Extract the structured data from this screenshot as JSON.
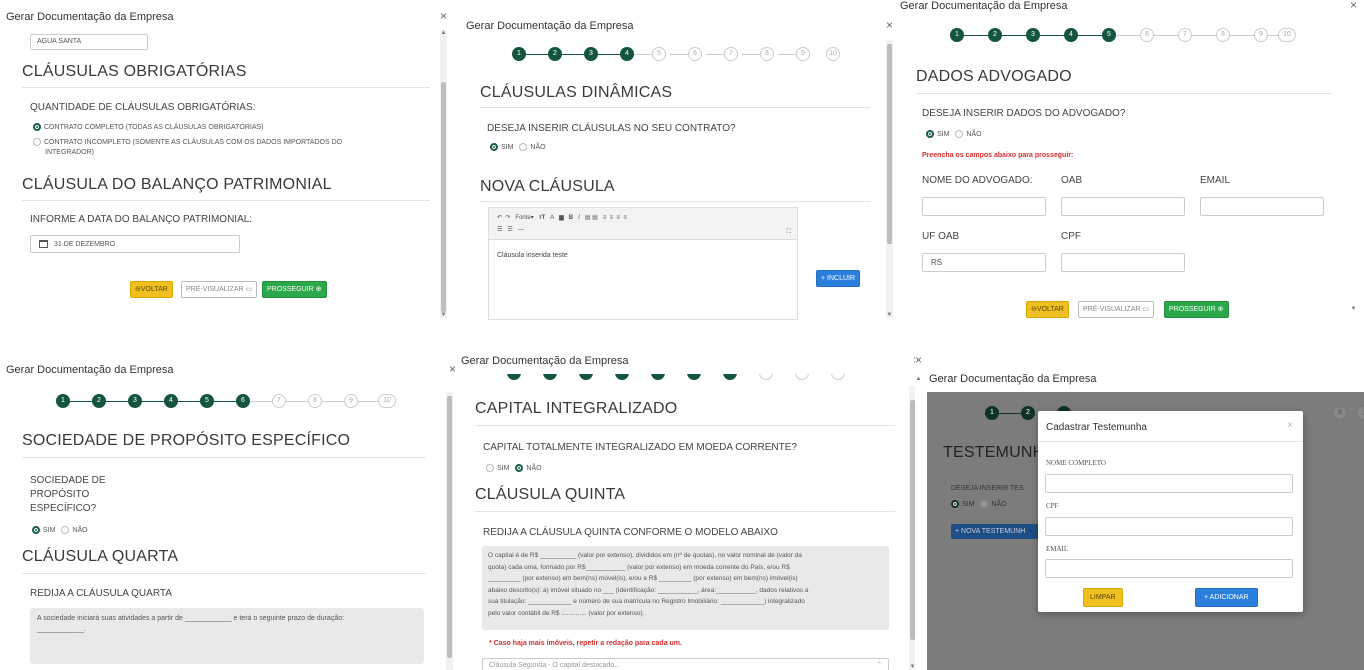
{
  "window_title": "Gerar Documentação da Empresa",
  "close_glyph": "×",
  "steps": [
    "1",
    "2",
    "3",
    "4",
    "5",
    "6",
    "7",
    "8",
    "9",
    "10"
  ],
  "btn": {
    "voltar": "VOLTAR",
    "previsualizar": "PRÉ-VISUALIZAR",
    "prosseguir": "PROSSEGUIR"
  },
  "radio": {
    "sim": "SIM",
    "nao": "NÃO"
  },
  "p1": {
    "city": "AGUA SANTA",
    "h1": "CLÁUSULAS OBRIGATÓRIAS",
    "q": "QUANTIDADE DE CLÁUSULAS OBRIGATÓRIAS:",
    "opt1": "CONTRATO COMPLETO (TODAS AS CLÁUSULAS OBRIGATÓRIAS)",
    "opt2a": "CONTRATO INCOMPLETO (SOMENTE AS CLÁUSULAS COM OS DADOS IMPORTADOS DO",
    "opt2b": "INTEGRADOR)",
    "h2": "CLÁUSULA DO BALANÇO PATRIMONIAL",
    "q2": "INFORME A DATA DO BALANÇO PATRIMONIAL:",
    "date": "31 DE DEZEMBRO"
  },
  "p2": {
    "h1": "CLÁUSULAS DINÂMICAS",
    "q": "DESEJA INSERIR CLÁUSULAS NO SEU CONTRATO?",
    "h2": "NOVA CLÁUSULA",
    "fonte": "Fonte",
    "editor_text": "Cláusula inserida teste",
    "incluir": "+ INCLUIR"
  },
  "p3": {
    "h1": "DADOS ADVOGADO",
    "q": "DESEJA INSERIR DADOS DO ADVOGADO?",
    "warn": "Preencha os campos abaixo para prosseguir:",
    "f_nome": "NOME DO ADVOGADO:",
    "f_oab": "OAB",
    "f_email": "EMAIL",
    "f_uf": "UF OAB",
    "f_cpf": "CPF",
    "uf_val": "RS"
  },
  "p4": {
    "h1": "SOCIEDADE DE PROPÓSITO ESPECÍFICO",
    "q1": "SOCIEDADE DE",
    "q2": "PROPÓSITO",
    "q3": "ESPECÍFICO?",
    "h2": "CLÁUSULA QUARTA",
    "q4": "REDIJA A CLÁUSULA QUARTA",
    "txt1": "A sociedade iniciará suas atividades a partir de ____________ e terá o seguinte prazo de duração:",
    "txt2": "____________."
  },
  "p5": {
    "h1": "CAPITAL INTEGRALIZADO",
    "q": "CAPITAL TOTALMENTE INTEGRALIZADO EM MOEDA CORRENTE?",
    "h2": "CLÁUSULA QUINTA",
    "q2": "REDIJA A CLÁUSULA QUINTA CONFORME O MODELO ABAIXO",
    "model": [
      "O capital é de R$ __________ (valor por extenso), divididos em (nº de quotas), no valor nominal de (valor da",
      "quota) cada uma, formado por R$___________ (valor por extenso) em moeda corrente do País, e/ou R$",
      "_________ (por extenso) em bem(ns) móvel(is), e/ou e R$ _________ (por extenso) em bem(ns) imóvel(is)",
      "abaixo descrito(s): a) imóvel situado no ___ (Identificação: ___________, área:___________, dados relativos a",
      "sua titulação: ____________ e número de sua matrícula no Registro Imobiliário: ____________) integralizado",
      "pelo valor contábil de R$ .............. (valor por extenso)."
    ],
    "warn": "* Caso haja mais imóveis, repetir a redação para cada um.",
    "select_placeholder": "Cláusula Segunda - O capital destacado..."
  },
  "p6": {
    "bg_h1": "TESTEMUNH",
    "bg_q": "DESEJA INSERIR TES",
    "bg_btn": "+ NOVA TESTEMUNH",
    "modal_title": "Cadastrar Testemunha",
    "f_nome": "NOME COMPLETO",
    "f_cpf": "CPF",
    "f_email": "EMAIL",
    "limpar": "LIMPAR",
    "adicionar": "+ ADICIONAR"
  }
}
